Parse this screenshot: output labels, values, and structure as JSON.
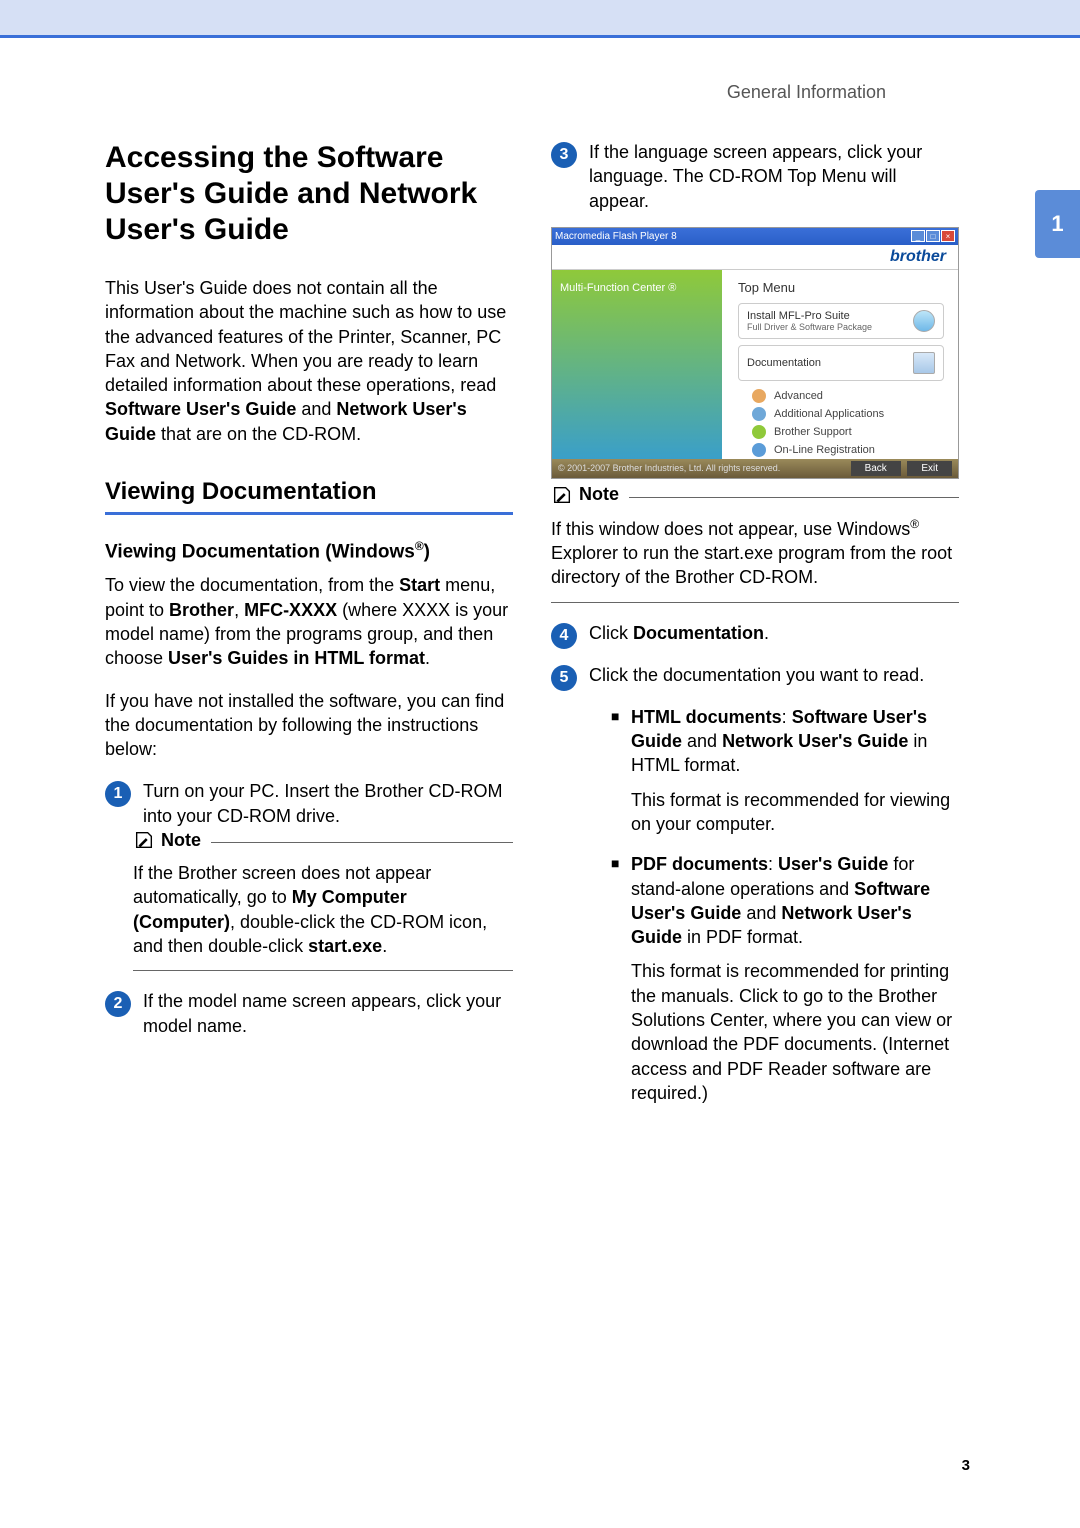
{
  "header": {
    "section": "General Information"
  },
  "tab": "1",
  "page_number": "3",
  "title": "Accessing the Software User's Guide and Network User's Guide",
  "intro": {
    "p1a": "This User's Guide does not contain all the information about the machine such as how to use the advanced features of the Printer, Scanner, PC Fax and Network. When you are ready to learn detailed information about these operations, read ",
    "p1b": "Software User's Guide",
    "p1c": " and ",
    "p1d": "Network User's Guide",
    "p1e": " that are on the CD-ROM."
  },
  "h2": "Viewing Documentation",
  "h3_base": "Viewing Documentation (Windows",
  "h3_sup": "®",
  "h3_end": ")",
  "win": {
    "p1a": "To view the documentation, from the ",
    "p1b": "Start",
    "p1c": " menu, point to ",
    "p1d": "Brother",
    "p1e": ", ",
    "p1f": "MFC-XXXX",
    "p1g": " (where XXXX is your model name) from the programs group, and then choose ",
    "p1h": "User's Guides in HTML format",
    "p1i": ".",
    "p2": "If you have not installed the software, you can find the documentation by following the instructions below:"
  },
  "steps": {
    "s1": "Turn on your PC. Insert the Brother CD-ROM into your CD-ROM drive.",
    "s2": "If the model name screen appears, click your model name.",
    "s3": "If the language screen appears, click your language. The CD-ROM Top Menu will appear.",
    "s4a": "Click ",
    "s4b": "Documentation",
    "s4c": ".",
    "s5": "Click the documentation you want to read."
  },
  "note_label": "Note",
  "note1": {
    "a": "If the Brother screen does not appear automatically, go to ",
    "b": "My Computer (Computer)",
    "c": ", double-click the CD-ROM icon, and then double-click ",
    "d": "start.exe",
    "e": "."
  },
  "note2": {
    "a": "If this window does not appear, use Windows",
    "sup": "®",
    "b": " Explorer to run the start.exe program from the root directory of the Brother CD-ROM."
  },
  "bullets": {
    "html": {
      "t": "HTML documents",
      "a": ": ",
      "b": "Software User's Guide",
      "c": " and ",
      "d": "Network User's Guide",
      "e": " in HTML format.",
      "p2": "This format is recommended for viewing on your computer."
    },
    "pdf": {
      "t": "PDF documents",
      "a": ": ",
      "b": "User's Guide",
      "c": " for stand-alone operations and ",
      "d": "Software User's Guide",
      "e": " and ",
      "f": "Network User's Guide",
      "g": " in PDF format.",
      "p2": "This format is recommended for printing the manuals. Click to go to the Brother Solutions Center, where you can view or download the PDF documents. (Internet access and PDF Reader software are required.)"
    }
  },
  "screenshot": {
    "titlebar": "Macromedia Flash Player 8",
    "brand": "brother",
    "side": "Multi-Function Center ®",
    "top": "Top Menu",
    "item1": "Install MFL-Pro Suite",
    "item1_sub": "Full Driver & Software Package",
    "item2": "Documentation",
    "li1": "Advanced",
    "li2": "Additional Applications",
    "li3": "Brother Support",
    "li4": "On-Line Registration",
    "copyright": "© 2001-2007 Brother Industries, Ltd. All rights reserved.",
    "back": "Back",
    "exit": "Exit"
  }
}
